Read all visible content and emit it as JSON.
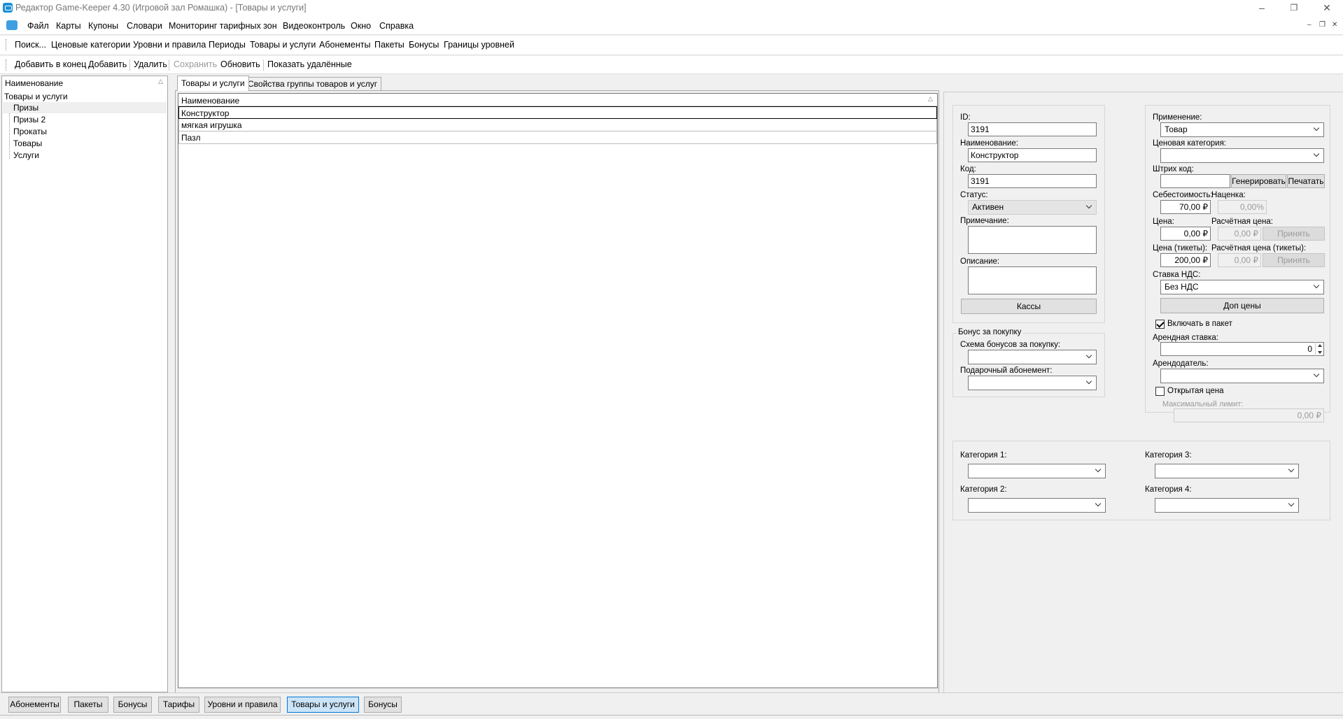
{
  "window": {
    "title": "Редактор Game-Keeper 4.30 (Игровой зал Ромашка) - [Товары и услуги]"
  },
  "menu": [
    "Файл",
    "Карты",
    "Купоны",
    "Словари",
    "Мониторинг тарифных зон",
    "Видеоконтроль",
    "Окно",
    "Справка"
  ],
  "nav": [
    "Поиск...",
    "Ценовые категории",
    "Уровни и правила",
    "Периоды",
    "Товары и услуги",
    "Абонементы",
    "Пакеты",
    "Бонусы",
    "Границы уровней"
  ],
  "toolbar": {
    "add_end": "Добавить в конец",
    "add": "Добавить",
    "delete": "Удалить",
    "save": "Сохранить",
    "refresh": "Обновить",
    "show_deleted": "Показать удалённые"
  },
  "tree": {
    "header": "Наименование",
    "root": "Товары и услуги",
    "children": [
      "Призы",
      "Призы 2",
      "Прокаты",
      "Товары",
      "Услуги"
    ]
  },
  "tabs": [
    "Товары и услуги",
    "Свойства группы товаров и услуг"
  ],
  "grid": {
    "header": "Наименование",
    "rows": [
      "Конструктор",
      "мягкая игрушка",
      "Пазл"
    ]
  },
  "form": {
    "id_label": "ID:",
    "id_value": "3191",
    "name_label": "Наименование:",
    "name_value": "Конструктор",
    "code_label": "Код:",
    "code_value": "3191",
    "status_label": "Статус:",
    "status_value": "Активен",
    "note_label": "Примечание:",
    "desc_label": "Описание:",
    "kassy_button": "Кассы",
    "bonus_group": "Бонус за покупку",
    "bonus_scheme_label": "Схема бонусов за покупку:",
    "gift_sub_label": "Подарочный абонемент:",
    "apply_label": "Применение:",
    "apply_value": "Товар",
    "price_cat_label": "Ценовая категория:",
    "barcode_label": "Штрих код:",
    "generate_button": "Генерировать",
    "print_button": "Печатать",
    "cost_label": "Себестоимость:",
    "cost_value": "70,00 ₽",
    "markup_label": "Наценка:",
    "markup_value": "0,00%",
    "price_label": "Цена:",
    "price_value": "0,00 ₽",
    "calc_price_label": "Расчётная цена:",
    "calc_price_value": "0,00 ₽",
    "accept_button": "Принять",
    "price_tickets_label": "Цена (тикеты):",
    "price_tickets_value": "200,00 ₽",
    "calc_price_tickets_label": "Расчётная цена (тикеты):",
    "calc_price_tickets_value": "0,00 ₽",
    "accept_button_2": "Принять",
    "vat_label": "Ставка НДС:",
    "vat_value": "Без НДС",
    "extra_prices_button": "Доп цены",
    "include_package_label": "Включать в пакет",
    "rent_rate_label": "Арендная ставка:",
    "rent_rate_value": "0",
    "landlord_label": "Арендодатель:",
    "open_price_label": "Открытая цена",
    "max_limit_label": "Максимальный лимит:",
    "max_limit_value": "0,00 ₽",
    "cat1_label": "Категория 1:",
    "cat2_label": "Категория 2:",
    "cat3_label": "Категория 3:",
    "cat4_label": "Категория 4:"
  },
  "bottom_tabs": [
    "Абонементы",
    "Пакеты",
    "Бонусы",
    "Тарифы",
    "Уровни и правила",
    "Товары и услуги",
    "Бонусы"
  ],
  "active_bottom_tab": "Товары и услуги"
}
